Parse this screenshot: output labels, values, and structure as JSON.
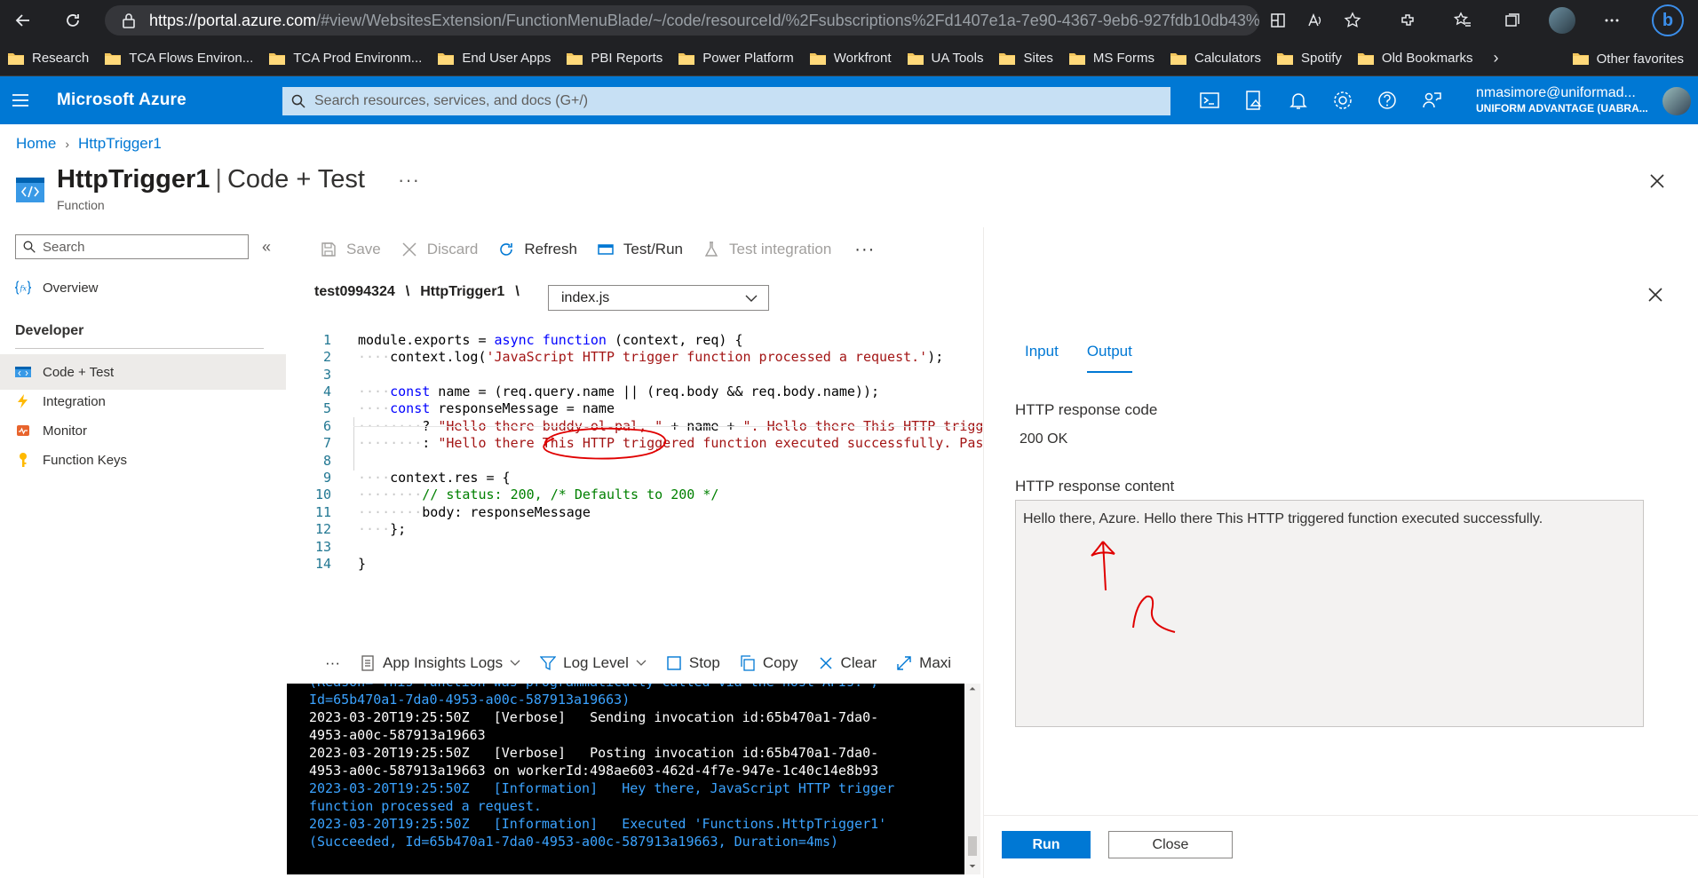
{
  "browser": {
    "url_host": "https://portal.azure.com",
    "url_rest": "/#view/WebsitesExtension/FunctionMenuBlade/~/code/resourceId/%2Fsubscriptions%2Fd1407e1a-7e90-4367-9eb6-927fdb10db43%...",
    "bing_label": "b"
  },
  "bookmarks": {
    "items": [
      "Research",
      "TCA Flows Environ...",
      "TCA Prod Environm...",
      "End User Apps",
      "PBI Reports",
      "Power Platform",
      "Workfront",
      "UA Tools",
      "Sites",
      "MS Forms",
      "Calculators",
      "Spotify",
      "Old Bookmarks"
    ],
    "more": "›",
    "other": "Other favorites"
  },
  "azure": {
    "brand": "Microsoft Azure",
    "search_placeholder": "Search resources, services, and docs (G+/)",
    "account_email": "nmasimore@uniformad...",
    "account_tenant": "UNIFORM ADVANTAGE (UABRA..."
  },
  "breadcrumb": [
    "Home",
    "HttpTrigger1"
  ],
  "page": {
    "title_bold": "HttpTrigger1",
    "title_sep": "|",
    "title_rest": "Code + Test",
    "subtitle": "Function",
    "more": "···"
  },
  "leftnav": {
    "search_placeholder": "Search",
    "collapse": "«",
    "overview": "Overview",
    "section": "Developer",
    "items": [
      "Code + Test",
      "Integration",
      "Monitor",
      "Function Keys"
    ]
  },
  "toolbar": {
    "save": "Save",
    "discard": "Discard",
    "refresh": "Refresh",
    "test_run": "Test/Run",
    "test_integration": "Test integration",
    "more": "···"
  },
  "file_path": {
    "app": "test0994324",
    "sep": "\\",
    "function": "HttpTrigger1",
    "file": "index.js"
  },
  "editor": {
    "line_numbers": [
      "1",
      "2",
      "3",
      "4",
      "5",
      "6",
      "7",
      "8",
      "9",
      "10",
      "11",
      "12",
      "13",
      "14"
    ]
  },
  "log_toolbar": {
    "more": "···",
    "app_insights": "App Insights Logs",
    "log_level": "Log Level",
    "stop": "Stop",
    "copy": "Copy",
    "clear": "Clear",
    "maximize": "Maxi"
  },
  "logs": [
    {
      "text": "(Reason='This function was programmatically called via the host APIs.',",
      "level": "info"
    },
    {
      "text": "Id=65b470a1-7da0-4953-a00c-587913a19663)",
      "level": "info"
    },
    {
      "text": "2023-03-20T19:25:50Z   [Verbose]   Sending invocation id:65b470a1-7da0-",
      "level": "verbose"
    },
    {
      "text": "4953-a00c-587913a19663",
      "level": "verbose"
    },
    {
      "text": "2023-03-20T19:25:50Z   [Verbose]   Posting invocation id:65b470a1-7da0-",
      "level": "verbose"
    },
    {
      "text": "4953-a00c-587913a19663 on workerId:498ae603-462d-4f7e-947e-1c40c14e8b93",
      "level": "verbose"
    },
    {
      "text": "2023-03-20T19:25:50Z   [Information]   Hey there, JavaScript HTTP trigger",
      "level": "info"
    },
    {
      "text": "function processed a request.",
      "level": "info"
    },
    {
      "text": "2023-03-20T19:25:50Z   [Information]   Executed 'Functions.HttpTrigger1'",
      "level": "info"
    },
    {
      "text": "(Succeeded, Id=65b470a1-7da0-4953-a00c-587913a19663, Duration=4ms)",
      "level": "info"
    }
  ],
  "test_panel": {
    "tabs": [
      "Input",
      "Output"
    ],
    "response_code_label": "HTTP response code",
    "response_code": "200 OK",
    "response_content_label": "HTTP response content",
    "response_content": "Hello there, Azure. Hello there This HTTP triggered function executed successfully.",
    "run": "Run",
    "close": "Close"
  },
  "colors": {
    "azure_blue": "#0078d4",
    "browser_dark": "#202124",
    "code_keyword": "#0000ff",
    "code_string": "#a31515",
    "code_comment": "#008000",
    "annotation_red": "#e00000"
  }
}
